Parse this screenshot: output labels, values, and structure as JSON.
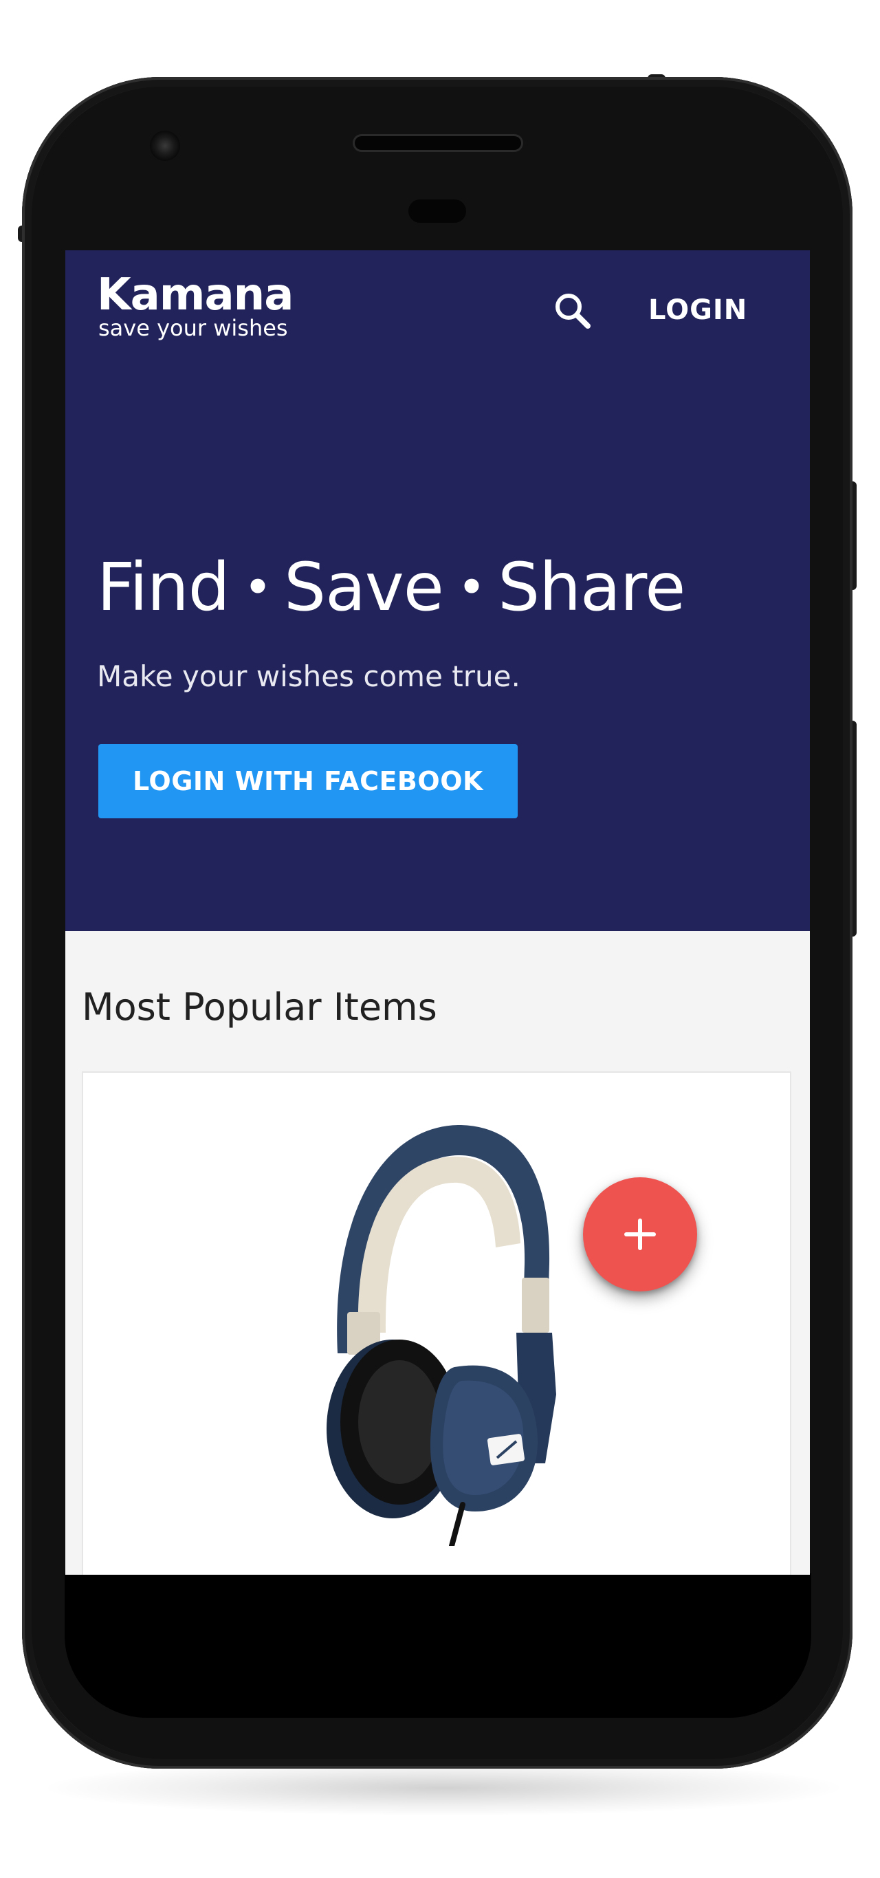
{
  "app": {
    "brand_name": "Kamana",
    "tagline": "save your wishes"
  },
  "header": {
    "search_icon": "search-icon",
    "login_label": "LOGIN"
  },
  "hero": {
    "headline_words": [
      "Find",
      "Save",
      "Share"
    ],
    "separator": "•",
    "subheadline": "Make your wishes come true.",
    "facebook_button_label": "LOGIN WITH FACEBOOK"
  },
  "popular": {
    "section_title": "Most Popular Items",
    "items": [
      {
        "image": "headphones"
      }
    ]
  },
  "fab": {
    "icon": "plus-icon"
  },
  "colors": {
    "hero_background": "#22235b",
    "facebook_button": "#2196f3",
    "fab": "#ef5350",
    "content_background": "#f4f4f4",
    "text_light": "#ffffff",
    "text_dark": "#212121"
  }
}
